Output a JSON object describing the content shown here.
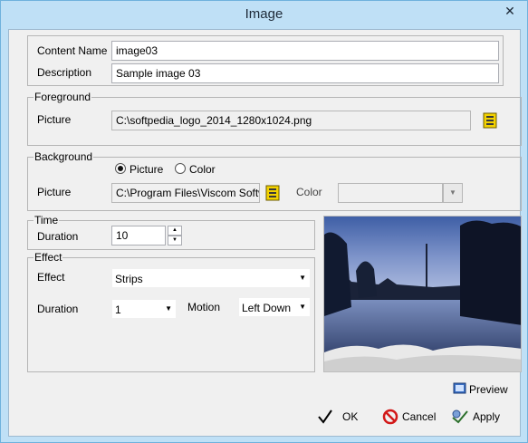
{
  "window": {
    "title": "Image",
    "close_glyph": "✕"
  },
  "content": {
    "name_label": "Content Name",
    "name_value": "image03",
    "description_label": "Description",
    "description_value": "Sample image 03"
  },
  "foreground": {
    "title": "Foreground",
    "picture_label": "Picture",
    "picture_value": "C:\\softpedia_logo_2014_1280x1024.png",
    "browse_icon": "folder-browse-icon"
  },
  "background": {
    "title": "Background",
    "radio_picture": "Picture",
    "radio_color": "Color",
    "selected": "Picture",
    "picture_label": "Picture",
    "picture_value": "C:\\Program Files\\Viscom Software",
    "browse_icon": "folder-browse-icon",
    "color_label": "Color",
    "color_value": ""
  },
  "time": {
    "title": "Time",
    "duration_label": "Duration",
    "duration_value": "10"
  },
  "effect": {
    "title": "Effect",
    "effect_label": "Effect",
    "effect_value": "Strips",
    "duration_label": "Duration",
    "duration_value": "1",
    "motion_label": "Motion",
    "motion_value": "Left Down"
  },
  "buttons": {
    "preview": "Preview",
    "ok": "OK",
    "cancel": "Cancel",
    "apply": "Apply"
  },
  "colors": {
    "title_bar": "#bfe0f6",
    "client": "#f0f0f0"
  }
}
